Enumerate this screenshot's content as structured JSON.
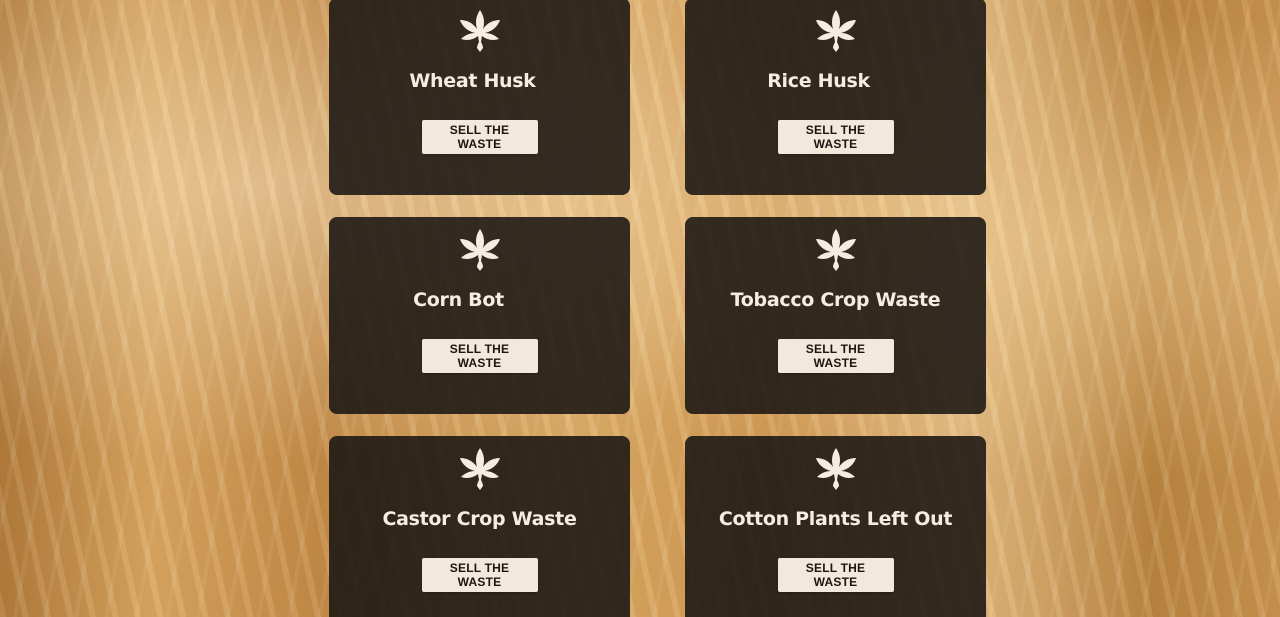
{
  "colors": {
    "card_background": "#1a1612",
    "title_text": "#f6ece2",
    "button_background": "#f3e8dc",
    "button_text": "#1c1610",
    "icon": "#f6ece2"
  },
  "cards": [
    {
      "title": "Wheat Husk",
      "icon": "leaf-icon",
      "button_label": "SELL THE WASTE"
    },
    {
      "title": "Rice Husk",
      "icon": "leaf-icon",
      "button_label": "SELL THE WASTE"
    },
    {
      "title": "Corn Bot",
      "icon": "leaf-icon",
      "button_label": "SELL THE WASTE"
    },
    {
      "title": "Tobacco Crop Waste",
      "icon": "leaf-icon",
      "button_label": "SELL THE WASTE"
    },
    {
      "title": "Castor Crop Waste",
      "icon": "leaf-icon",
      "button_label": "SELL THE WASTE"
    },
    {
      "title": "Cotton Plants Left Out",
      "icon": "leaf-icon",
      "button_label": "SELL THE WASTE"
    }
  ]
}
